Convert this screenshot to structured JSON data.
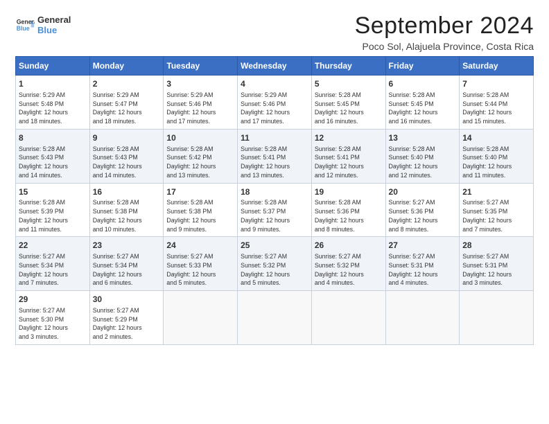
{
  "logo": {
    "line1": "General",
    "line2": "Blue"
  },
  "title": "September 2024",
  "subtitle": "Poco Sol, Alajuela Province, Costa Rica",
  "header": {
    "days": [
      "Sunday",
      "Monday",
      "Tuesday",
      "Wednesday",
      "Thursday",
      "Friday",
      "Saturday"
    ]
  },
  "weeks": [
    [
      {
        "day": "1",
        "info": "Sunrise: 5:29 AM\nSunset: 5:48 PM\nDaylight: 12 hours\nand 18 minutes."
      },
      {
        "day": "2",
        "info": "Sunrise: 5:29 AM\nSunset: 5:47 PM\nDaylight: 12 hours\nand 18 minutes."
      },
      {
        "day": "3",
        "info": "Sunrise: 5:29 AM\nSunset: 5:46 PM\nDaylight: 12 hours\nand 17 minutes."
      },
      {
        "day": "4",
        "info": "Sunrise: 5:29 AM\nSunset: 5:46 PM\nDaylight: 12 hours\nand 17 minutes."
      },
      {
        "day": "5",
        "info": "Sunrise: 5:28 AM\nSunset: 5:45 PM\nDaylight: 12 hours\nand 16 minutes."
      },
      {
        "day": "6",
        "info": "Sunrise: 5:28 AM\nSunset: 5:45 PM\nDaylight: 12 hours\nand 16 minutes."
      },
      {
        "day": "7",
        "info": "Sunrise: 5:28 AM\nSunset: 5:44 PM\nDaylight: 12 hours\nand 15 minutes."
      }
    ],
    [
      {
        "day": "8",
        "info": "Sunrise: 5:28 AM\nSunset: 5:43 PM\nDaylight: 12 hours\nand 14 minutes."
      },
      {
        "day": "9",
        "info": "Sunrise: 5:28 AM\nSunset: 5:43 PM\nDaylight: 12 hours\nand 14 minutes."
      },
      {
        "day": "10",
        "info": "Sunrise: 5:28 AM\nSunset: 5:42 PM\nDaylight: 12 hours\nand 13 minutes."
      },
      {
        "day": "11",
        "info": "Sunrise: 5:28 AM\nSunset: 5:41 PM\nDaylight: 12 hours\nand 13 minutes."
      },
      {
        "day": "12",
        "info": "Sunrise: 5:28 AM\nSunset: 5:41 PM\nDaylight: 12 hours\nand 12 minutes."
      },
      {
        "day": "13",
        "info": "Sunrise: 5:28 AM\nSunset: 5:40 PM\nDaylight: 12 hours\nand 12 minutes."
      },
      {
        "day": "14",
        "info": "Sunrise: 5:28 AM\nSunset: 5:40 PM\nDaylight: 12 hours\nand 11 minutes."
      }
    ],
    [
      {
        "day": "15",
        "info": "Sunrise: 5:28 AM\nSunset: 5:39 PM\nDaylight: 12 hours\nand 11 minutes."
      },
      {
        "day": "16",
        "info": "Sunrise: 5:28 AM\nSunset: 5:38 PM\nDaylight: 12 hours\nand 10 minutes."
      },
      {
        "day": "17",
        "info": "Sunrise: 5:28 AM\nSunset: 5:38 PM\nDaylight: 12 hours\nand 9 minutes."
      },
      {
        "day": "18",
        "info": "Sunrise: 5:28 AM\nSunset: 5:37 PM\nDaylight: 12 hours\nand 9 minutes."
      },
      {
        "day": "19",
        "info": "Sunrise: 5:28 AM\nSunset: 5:36 PM\nDaylight: 12 hours\nand 8 minutes."
      },
      {
        "day": "20",
        "info": "Sunrise: 5:27 AM\nSunset: 5:36 PM\nDaylight: 12 hours\nand 8 minutes."
      },
      {
        "day": "21",
        "info": "Sunrise: 5:27 AM\nSunset: 5:35 PM\nDaylight: 12 hours\nand 7 minutes."
      }
    ],
    [
      {
        "day": "22",
        "info": "Sunrise: 5:27 AM\nSunset: 5:34 PM\nDaylight: 12 hours\nand 7 minutes."
      },
      {
        "day": "23",
        "info": "Sunrise: 5:27 AM\nSunset: 5:34 PM\nDaylight: 12 hours\nand 6 minutes."
      },
      {
        "day": "24",
        "info": "Sunrise: 5:27 AM\nSunset: 5:33 PM\nDaylight: 12 hours\nand 5 minutes."
      },
      {
        "day": "25",
        "info": "Sunrise: 5:27 AM\nSunset: 5:32 PM\nDaylight: 12 hours\nand 5 minutes."
      },
      {
        "day": "26",
        "info": "Sunrise: 5:27 AM\nSunset: 5:32 PM\nDaylight: 12 hours\nand 4 minutes."
      },
      {
        "day": "27",
        "info": "Sunrise: 5:27 AM\nSunset: 5:31 PM\nDaylight: 12 hours\nand 4 minutes."
      },
      {
        "day": "28",
        "info": "Sunrise: 5:27 AM\nSunset: 5:31 PM\nDaylight: 12 hours\nand 3 minutes."
      }
    ],
    [
      {
        "day": "29",
        "info": "Sunrise: 5:27 AM\nSunset: 5:30 PM\nDaylight: 12 hours\nand 3 minutes."
      },
      {
        "day": "30",
        "info": "Sunrise: 5:27 AM\nSunset: 5:29 PM\nDaylight: 12 hours\nand 2 minutes."
      },
      {
        "day": "",
        "info": ""
      },
      {
        "day": "",
        "info": ""
      },
      {
        "day": "",
        "info": ""
      },
      {
        "day": "",
        "info": ""
      },
      {
        "day": "",
        "info": ""
      }
    ]
  ]
}
